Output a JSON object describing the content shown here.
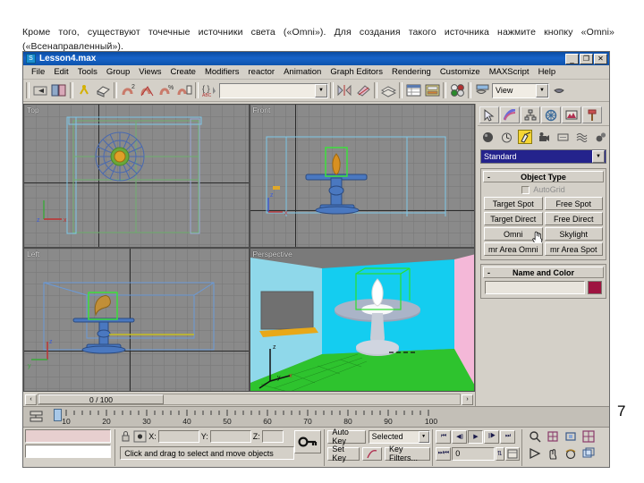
{
  "caption": {
    "text": "Кроме того, существуют точечные источники света («Omni»). Для создания такого источника нажмите кнопку «Omni» («Всенаправленный»)."
  },
  "page_number": "7",
  "window": {
    "title": "Lesson4.max",
    "app_icon": "max-logo-icon",
    "buttons": {
      "minimize": "_",
      "maximize": "❐",
      "close": "✕"
    }
  },
  "menu": {
    "items": [
      "File",
      "Edit",
      "Tools",
      "Group",
      "Views",
      "Create",
      "Modifiers",
      "reactor",
      "Animation",
      "Graph Editors",
      "Rendering",
      "Customize",
      "MAXScript",
      "Help"
    ]
  },
  "toolbar": {
    "named_selection_placeholder": "",
    "named_selection_value": "",
    "coordinate_system_value": "View",
    "icons": [
      "undo-icon",
      "redo-icon",
      "select-link-icon",
      "unlink-icon",
      "bind-space-warp-icon",
      "select-object-icon",
      "select-region-icon",
      "select-move-icon",
      "select-rotate-icon",
      "select-scale-icon",
      "mirror-icon",
      "align-icon",
      "layer-manager-icon",
      "curve-editor-icon",
      "schematic-view-icon",
      "material-editor-icon",
      "render-scene-icon",
      "quick-render-icon"
    ]
  },
  "viewports": [
    {
      "label": "Top",
      "active": false,
      "bg": "#8a8a8a"
    },
    {
      "label": "Front",
      "active": false,
      "bg": "#8a8a8a"
    },
    {
      "label": "Left",
      "active": false,
      "bg": "#8a8a8a"
    },
    {
      "label": "Perspective",
      "active": true,
      "bg": "#39c9e8"
    }
  ],
  "command_panel": {
    "tabs": [
      {
        "name": "create-tab",
        "icon": "arrow-cursor-icon",
        "active": true
      },
      {
        "name": "modify-tab",
        "icon": "curve-icon",
        "active": false
      },
      {
        "name": "hierarchy-tab",
        "icon": "hierarchy-icon",
        "active": false
      },
      {
        "name": "motion-tab",
        "icon": "wheel-icon",
        "active": false
      },
      {
        "name": "display-tab",
        "icon": "monitor-icon",
        "active": false
      },
      {
        "name": "utilities-tab",
        "icon": "hammer-icon",
        "active": false
      }
    ],
    "categories": [
      {
        "name": "geometry-category",
        "icon": "sphere-icon",
        "active": false
      },
      {
        "name": "shapes-category",
        "icon": "shapes-icon",
        "active": false
      },
      {
        "name": "lights-category",
        "icon": "light-icon",
        "active": true
      },
      {
        "name": "cameras-category",
        "icon": "camera-icon",
        "active": false
      },
      {
        "name": "helpers-category",
        "icon": "helper-icon",
        "active": false
      },
      {
        "name": "space-warps-category",
        "icon": "waves-icon",
        "active": false
      },
      {
        "name": "systems-category",
        "icon": "gears-icon",
        "active": false
      }
    ],
    "subcategory_value": "Standard",
    "object_type": {
      "title": "Object Type",
      "collapse_glyph": "-",
      "autogrid_label": "AutoGrid",
      "autogrid_checked": false,
      "buttons": [
        "Target Spot",
        "Free Spot",
        "Target Direct",
        "Free Direct",
        "Omni",
        "Skylight",
        "mr Area Omni",
        "mr Area Spot"
      ],
      "hovered_button": "Omni"
    },
    "name_and_color": {
      "title": "Name and Color",
      "collapse_glyph": "-",
      "name_value": "",
      "color": "#9e1440"
    }
  },
  "track_bar": {
    "prev_glyph": "‹",
    "next_glyph": "›",
    "range_label": "0 / 100"
  },
  "timeline": {
    "ticks": [
      "10",
      "20",
      "30",
      "40",
      "50",
      "60",
      "70",
      "80",
      "90",
      "100"
    ],
    "current_frame": "0"
  },
  "status_bar": {
    "lock_icon": "lock-icon",
    "absolute_mode_icon": "absolute-relative-icon",
    "x_label": "X:",
    "y_label": "Y:",
    "z_label": "Z:",
    "x_value": "",
    "y_value": "",
    "z_value": "",
    "key_mode_icon": "key-icon",
    "prompt": "Click and drag to select and move objects",
    "auto_key_label": "Auto Key",
    "set_key_label": "Set Key",
    "key_filters_label": "Key Filters...",
    "selection_level_value": "Selected",
    "curve_icon": "function-curve-icon",
    "frame_value": "0",
    "playback_icons": [
      "go-to-start-icon",
      "previous-frame-icon",
      "play-animation-icon",
      "next-frame-icon",
      "go-to-end-icon"
    ],
    "viewport_nav_icons": [
      "zoom-icon",
      "zoom-all-icon",
      "zoom-extents-icon",
      "zoom-extents-all-icon",
      "field-of-view-icon",
      "pan-icon",
      "arc-rotate-icon",
      "maximize-viewport-icon"
    ]
  }
}
